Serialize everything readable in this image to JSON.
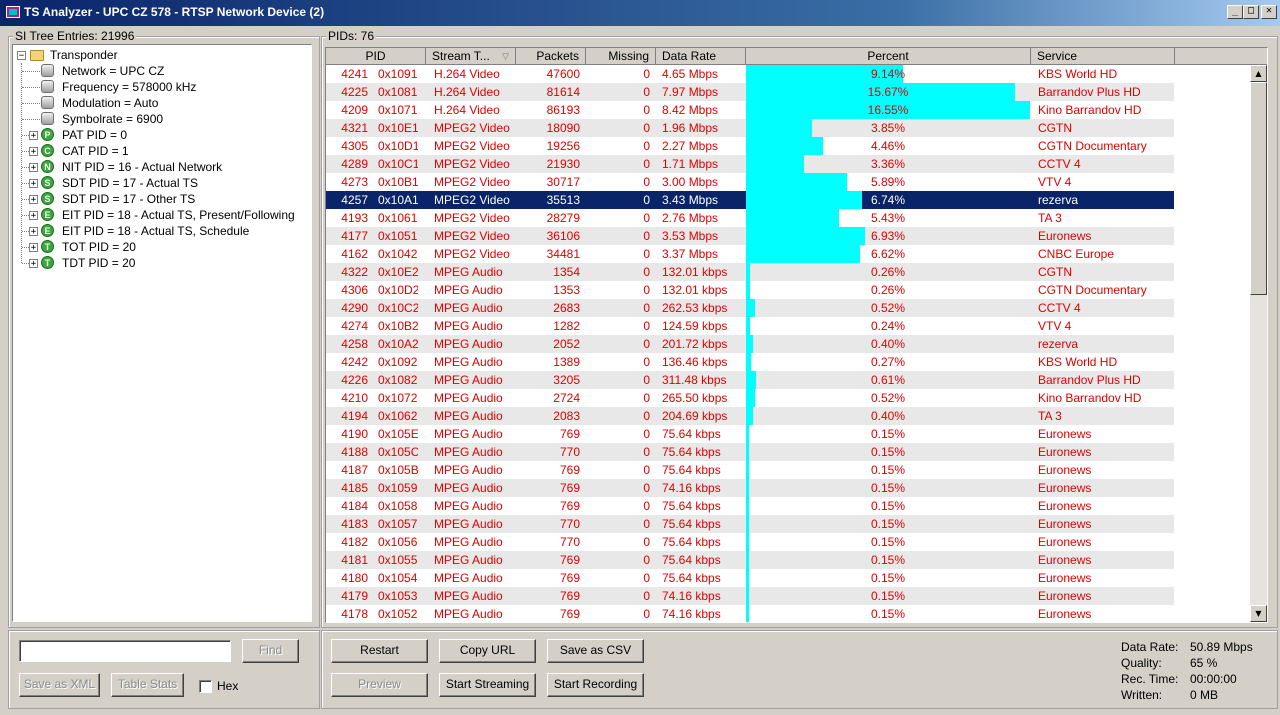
{
  "window": {
    "title": "TS Analyzer - UPC CZ 578 - RTSP Network Device (2)",
    "controls": [
      "_",
      "□",
      "✕"
    ]
  },
  "si_tree": {
    "group_label": "SI Tree Entries: 21996",
    "root": "Transponder",
    "root_children": [
      "Network = UPC CZ",
      "Frequency = 578000 kHz",
      "Modulation = Auto",
      "Symbolrate = 6900"
    ],
    "tables": [
      {
        "badge": "P",
        "label": "PAT PID = 0"
      },
      {
        "badge": "C",
        "label": "CAT PID = 1"
      },
      {
        "badge": "N",
        "label": "NIT PID = 16 - Actual Network"
      },
      {
        "badge": "S",
        "label": "SDT PID = 17 - Actual TS"
      },
      {
        "badge": "S",
        "label": "SDT PID = 17 - Other TS"
      },
      {
        "badge": "E",
        "label": "EIT PID = 18 - Actual TS, Present/Following"
      },
      {
        "badge": "E",
        "label": "EIT PID = 18 - Actual TS, Schedule"
      },
      {
        "badge": "T",
        "label": "TOT PID = 20"
      },
      {
        "badge": "T",
        "label": "TDT PID = 20"
      }
    ]
  },
  "search": {
    "value": "",
    "find_label": "Find",
    "save_xml_label": "Save as XML",
    "table_stats_label": "Table Stats",
    "hex_label": "Hex"
  },
  "pids": {
    "group_label": "PIDs: 76",
    "columns": [
      "PID",
      "Stream T...",
      "Packets",
      "Missing",
      "Data Rate",
      "Percent",
      "Service"
    ],
    "selected_index": 7,
    "rows": [
      {
        "pid": "4241",
        "hex": "0x1091",
        "type": "H.264 Video",
        "packets": "47600",
        "missing": "0",
        "rate": "4.65 Mbps",
        "percent": "9.14%",
        "pct": 9.14,
        "service": "KBS World HD"
      },
      {
        "pid": "4225",
        "hex": "0x1081",
        "type": "H.264 Video",
        "packets": "81614",
        "missing": "0",
        "rate": "7.97 Mbps",
        "percent": "15.67%",
        "pct": 15.67,
        "service": "Barrandov Plus HD"
      },
      {
        "pid": "4209",
        "hex": "0x1071",
        "type": "H.264 Video",
        "packets": "86193",
        "missing": "0",
        "rate": "8.42 Mbps",
        "percent": "16.55%",
        "pct": 16.55,
        "service": "Kino Barrandov HD"
      },
      {
        "pid": "4321",
        "hex": "0x10E1",
        "type": "MPEG2 Video",
        "packets": "18090",
        "missing": "0",
        "rate": "1.96 Mbps",
        "percent": "3.85%",
        "pct": 3.85,
        "service": "CGTN"
      },
      {
        "pid": "4305",
        "hex": "0x10D1",
        "type": "MPEG2 Video",
        "packets": "19256",
        "missing": "0",
        "rate": "2.27 Mbps",
        "percent": "4.46%",
        "pct": 4.46,
        "service": "CGTN Documentary"
      },
      {
        "pid": "4289",
        "hex": "0x10C1",
        "type": "MPEG2 Video",
        "packets": "21930",
        "missing": "0",
        "rate": "1.71 Mbps",
        "percent": "3.36%",
        "pct": 3.36,
        "service": "CCTV 4"
      },
      {
        "pid": "4273",
        "hex": "0x10B1",
        "type": "MPEG2 Video",
        "packets": "30717",
        "missing": "0",
        "rate": "3.00 Mbps",
        "percent": "5.89%",
        "pct": 5.89,
        "service": "VTV 4"
      },
      {
        "pid": "4257",
        "hex": "0x10A1",
        "type": "MPEG2 Video",
        "packets": "35513",
        "missing": "0",
        "rate": "3.43 Mbps",
        "percent": "6.74%",
        "pct": 6.74,
        "service": "rezerva"
      },
      {
        "pid": "4193",
        "hex": "0x1061",
        "type": "MPEG2 Video",
        "packets": "28279",
        "missing": "0",
        "rate": "2.76 Mbps",
        "percent": "5.43%",
        "pct": 5.43,
        "service": "TA 3"
      },
      {
        "pid": "4177",
        "hex": "0x1051",
        "type": "MPEG2 Video",
        "packets": "36106",
        "missing": "0",
        "rate": "3.53 Mbps",
        "percent": "6.93%",
        "pct": 6.93,
        "service": "Euronews"
      },
      {
        "pid": "4162",
        "hex": "0x1042",
        "type": "MPEG2 Video",
        "packets": "34481",
        "missing": "0",
        "rate": "3.37 Mbps",
        "percent": "6.62%",
        "pct": 6.62,
        "service": "CNBC Europe"
      },
      {
        "pid": "4322",
        "hex": "0x10E2",
        "type": "MPEG Audio",
        "packets": "1354",
        "missing": "0",
        "rate": "132.01 kbps",
        "percent": "0.26%",
        "pct": 0.26,
        "service": "CGTN"
      },
      {
        "pid": "4306",
        "hex": "0x10D2",
        "type": "MPEG Audio",
        "packets": "1353",
        "missing": "0",
        "rate": "132.01 kbps",
        "percent": "0.26%",
        "pct": 0.26,
        "service": "CGTN Documentary"
      },
      {
        "pid": "4290",
        "hex": "0x10C2",
        "type": "MPEG Audio",
        "packets": "2683",
        "missing": "0",
        "rate": "262.53 kbps",
        "percent": "0.52%",
        "pct": 0.52,
        "service": "CCTV 4"
      },
      {
        "pid": "4274",
        "hex": "0x10B2",
        "type": "MPEG Audio",
        "packets": "1282",
        "missing": "0",
        "rate": "124.59 kbps",
        "percent": "0.24%",
        "pct": 0.24,
        "service": "VTV 4"
      },
      {
        "pid": "4258",
        "hex": "0x10A2",
        "type": "MPEG Audio",
        "packets": "2052",
        "missing": "0",
        "rate": "201.72 kbps",
        "percent": "0.40%",
        "pct": 0.4,
        "service": "rezerva"
      },
      {
        "pid": "4242",
        "hex": "0x1092",
        "type": "MPEG Audio",
        "packets": "1389",
        "missing": "0",
        "rate": "136.46 kbps",
        "percent": "0.27%",
        "pct": 0.27,
        "service": "KBS World HD"
      },
      {
        "pid": "4226",
        "hex": "0x1082",
        "type": "MPEG Audio",
        "packets": "3205",
        "missing": "0",
        "rate": "311.48 kbps",
        "percent": "0.61%",
        "pct": 0.61,
        "service": "Barrandov Plus HD"
      },
      {
        "pid": "4210",
        "hex": "0x1072",
        "type": "MPEG Audio",
        "packets": "2724",
        "missing": "0",
        "rate": "265.50 kbps",
        "percent": "0.52%",
        "pct": 0.52,
        "service": "Kino Barrandov HD"
      },
      {
        "pid": "4194",
        "hex": "0x1062",
        "type": "MPEG Audio",
        "packets": "2083",
        "missing": "0",
        "rate": "204.69 kbps",
        "percent": "0.40%",
        "pct": 0.4,
        "service": "TA 3"
      },
      {
        "pid": "4190",
        "hex": "0x105E",
        "type": "MPEG Audio",
        "packets": "769",
        "missing": "0",
        "rate": "75.64 kbps",
        "percent": "0.15%",
        "pct": 0.15,
        "service": "Euronews"
      },
      {
        "pid": "4188",
        "hex": "0x105C",
        "type": "MPEG Audio",
        "packets": "770",
        "missing": "0",
        "rate": "75.64 kbps",
        "percent": "0.15%",
        "pct": 0.15,
        "service": "Euronews"
      },
      {
        "pid": "4187",
        "hex": "0x105B",
        "type": "MPEG Audio",
        "packets": "769",
        "missing": "0",
        "rate": "75.64 kbps",
        "percent": "0.15%",
        "pct": 0.15,
        "service": "Euronews"
      },
      {
        "pid": "4185",
        "hex": "0x1059",
        "type": "MPEG Audio",
        "packets": "769",
        "missing": "0",
        "rate": "74.16 kbps",
        "percent": "0.15%",
        "pct": 0.15,
        "service": "Euronews"
      },
      {
        "pid": "4184",
        "hex": "0x1058",
        "type": "MPEG Audio",
        "packets": "769",
        "missing": "0",
        "rate": "75.64 kbps",
        "percent": "0.15%",
        "pct": 0.15,
        "service": "Euronews"
      },
      {
        "pid": "4183",
        "hex": "0x1057",
        "type": "MPEG Audio",
        "packets": "770",
        "missing": "0",
        "rate": "75.64 kbps",
        "percent": "0.15%",
        "pct": 0.15,
        "service": "Euronews"
      },
      {
        "pid": "4182",
        "hex": "0x1056",
        "type": "MPEG Audio",
        "packets": "770",
        "missing": "0",
        "rate": "75.64 kbps",
        "percent": "0.15%",
        "pct": 0.15,
        "service": "Euronews"
      },
      {
        "pid": "4181",
        "hex": "0x1055",
        "type": "MPEG Audio",
        "packets": "769",
        "missing": "0",
        "rate": "75.64 kbps",
        "percent": "0.15%",
        "pct": 0.15,
        "service": "Euronews"
      },
      {
        "pid": "4180",
        "hex": "0x1054",
        "type": "MPEG Audio",
        "packets": "769",
        "missing": "0",
        "rate": "75.64 kbps",
        "percent": "0.15%",
        "pct": 0.15,
        "service": "Euronews"
      },
      {
        "pid": "4179",
        "hex": "0x1053",
        "type": "MPEG Audio",
        "packets": "769",
        "missing": "0",
        "rate": "74.16 kbps",
        "percent": "0.15%",
        "pct": 0.15,
        "service": "Euronews"
      },
      {
        "pid": "4178",
        "hex": "0x1052",
        "type": "MPEG Audio",
        "packets": "769",
        "missing": "0",
        "rate": "74.16 kbps",
        "percent": "0.15%",
        "pct": 0.15,
        "service": "Euronews"
      }
    ]
  },
  "actions": {
    "restart": "Restart",
    "copy_url": "Copy URL",
    "save_csv": "Save as CSV",
    "preview": "Preview",
    "start_streaming": "Start Streaming",
    "start_recording": "Start Recording"
  },
  "status": {
    "data_rate_label": "Data Rate:",
    "data_rate": "50.89 Mbps",
    "quality_label": "Quality:",
    "quality": "65 %",
    "rec_time_label": "Rec. Time:",
    "rec_time": "00:00:00",
    "written_label": "Written:",
    "written": "0 MB"
  },
  "colors": {
    "text_red": "#e00000",
    "bar_cyan": "#00ffff",
    "selection": "#0a246a",
    "title_gradient_start": "#0a246a"
  },
  "icons": {
    "tree_badge": "green-circle-letter-icon",
    "tree_leaf": "gray-square-icon",
    "tree_root": "folder-icon"
  }
}
